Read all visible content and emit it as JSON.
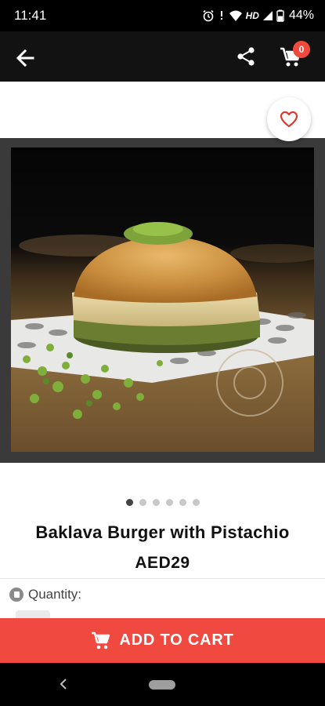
{
  "status_bar": {
    "time": "11:41",
    "network": "HD",
    "battery": "44%"
  },
  "app_bar": {
    "back_icon": "arrow-left-icon",
    "share_icon": "share-icon",
    "cart_icon": "cart-icon",
    "cart_count": "0",
    "badge_color": "#f0493e"
  },
  "product": {
    "favorite_icon": "heart-outline-icon",
    "image_description_icon": "product-photo",
    "carousel_total": 6,
    "carousel_active": 1,
    "title": "Baklava Burger with Pistachio",
    "price": "AED29",
    "quantity_label": "Quantity:"
  },
  "actions": {
    "add_to_cart_label": "ADD TO CART",
    "add_to_cart_color": "#f04a40"
  },
  "colors": {
    "app_bar": "#121212",
    "status_bar": "#000000",
    "accent": "#f04a40"
  }
}
